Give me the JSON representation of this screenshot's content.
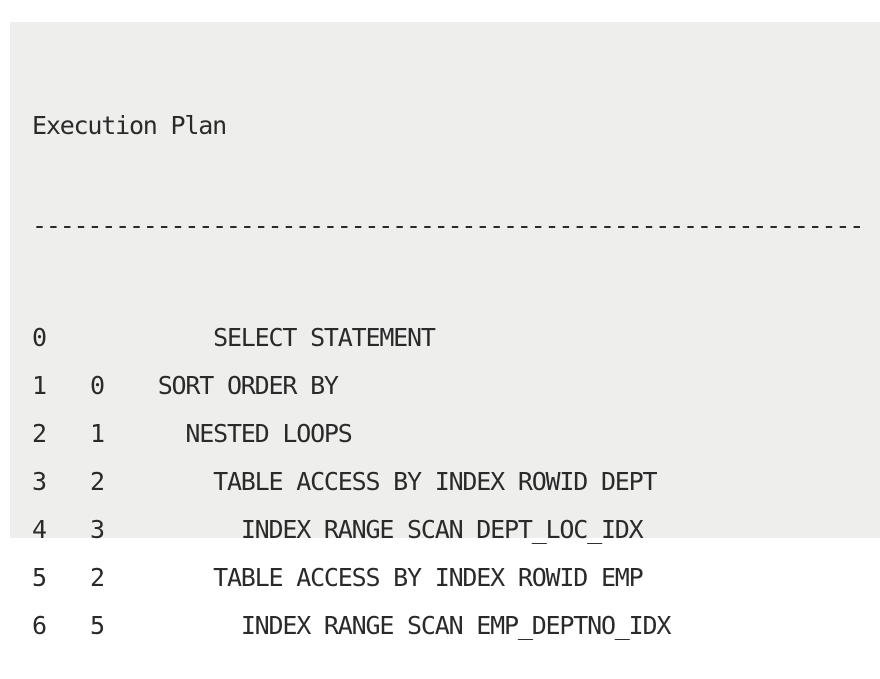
{
  "title": "Execution Plan",
  "rule": "------------------------------------------------------------",
  "rows": [
    {
      "id": "0",
      "parent": "",
      "indent": "      ",
      "operation": "SELECT STATEMENT"
    },
    {
      "id": "1",
      "parent": "0",
      "indent": "  ",
      "operation": "SORT ORDER BY"
    },
    {
      "id": "2",
      "parent": "1",
      "indent": "    ",
      "operation": "NESTED LOOPS"
    },
    {
      "id": "3",
      "parent": "2",
      "indent": "      ",
      "operation": "TABLE ACCESS BY INDEX ROWID DEPT"
    },
    {
      "id": "4",
      "parent": "3",
      "indent": "        ",
      "operation": "INDEX RANGE SCAN DEPT_LOC_IDX"
    },
    {
      "id": "5",
      "parent": "2",
      "indent": "      ",
      "operation": "TABLE ACCESS BY INDEX ROWID EMP"
    },
    {
      "id": "6",
      "parent": "5",
      "indent": "        ",
      "operation": "INDEX RANGE SCAN EMP_DEPTNO_IDX"
    }
  ]
}
